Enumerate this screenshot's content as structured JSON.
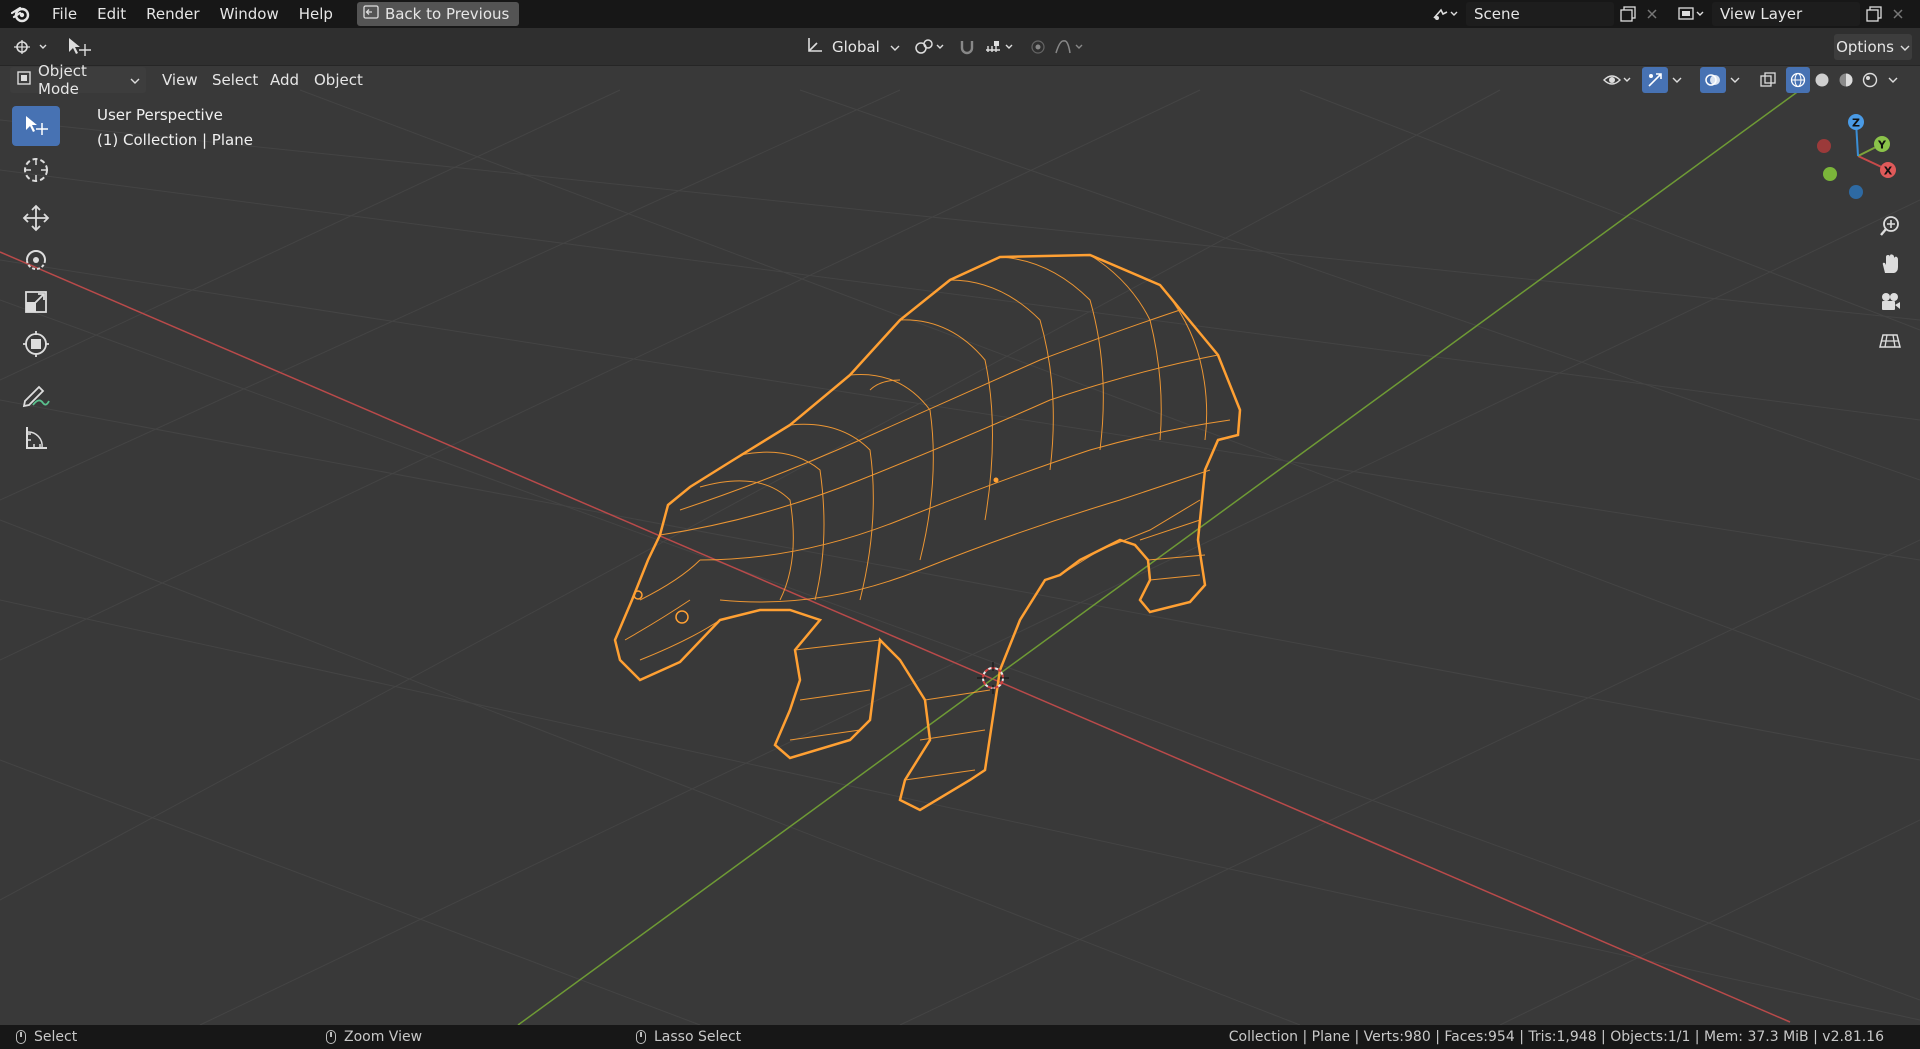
{
  "app": {
    "menus": [
      "File",
      "Edit",
      "Render",
      "Window",
      "Help"
    ],
    "back_button": "Back to Previous",
    "scene_name": "Scene",
    "view_layer": "View Layer"
  },
  "tool_header": {
    "transform_orientation": "Global",
    "options_label": "Options"
  },
  "view_header": {
    "mode": "Object Mode",
    "menus": [
      "View",
      "Select",
      "Add",
      "Object"
    ]
  },
  "viewport": {
    "perspective_label": "User Perspective",
    "collection_label": "(1) Collection | Plane",
    "axis_colors": {
      "x": "#c74a4a",
      "y": "#7da33a",
      "z": "#3b8fd6"
    },
    "selection_color": "#ffa033",
    "gizmo": {
      "x": "X",
      "y": "Y",
      "z": "Z"
    }
  },
  "toolbar": {
    "tools": [
      "select-box-icon",
      "cursor-icon",
      "move-icon",
      "rotate-icon",
      "scale-icon",
      "transform-icon",
      "annotate-icon",
      "measure-icon"
    ],
    "active_tool": "select-box-icon"
  },
  "statusbar": {
    "left_action": "Select",
    "middle_action": "Zoom View",
    "right_action": "Lasso Select",
    "stats": "Collection | Plane | Verts:980 | Faces:954 | Tris:1,948 | Objects:1/1 | Mem: 37.3 MiB | v2.81.16"
  }
}
